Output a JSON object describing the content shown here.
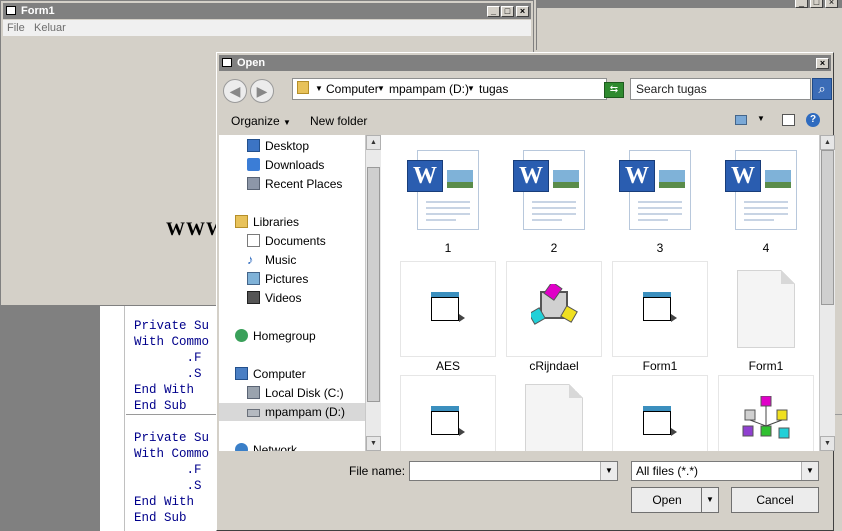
{
  "background_form": {
    "title": "Form1",
    "menu": [
      "File",
      "Keluar"
    ],
    "body_text": "WWW"
  },
  "code_editor": {
    "lines": [
      "Private Su",
      "With Commo",
      "       .F",
      "       .S",
      "End With",
      "End Sub",
      "Private Su",
      "With Commo",
      "       .F",
      "       .S",
      "End With",
      "End Sub"
    ]
  },
  "dialog": {
    "title": "Open",
    "breadcrumb": [
      "Computer",
      "mpampam (D:)",
      "tugas"
    ],
    "search_placeholder": "Search tugas",
    "toolbar": {
      "organize": "Organize",
      "new_folder": "New folder"
    },
    "nav": [
      {
        "label": "Desktop",
        "icon": "desktop-icon"
      },
      {
        "label": "Downloads",
        "icon": "downloads-icon"
      },
      {
        "label": "Recent Places",
        "icon": "recent-places-icon"
      },
      {
        "label": "Libraries",
        "icon": "libraries-icon"
      },
      {
        "label": "Documents",
        "icon": "documents-icon"
      },
      {
        "label": "Music",
        "icon": "music-icon"
      },
      {
        "label": "Pictures",
        "icon": "pictures-icon"
      },
      {
        "label": "Videos",
        "icon": "videos-icon"
      },
      {
        "label": "Homegroup",
        "icon": "homegroup-icon"
      },
      {
        "label": "Computer",
        "icon": "computer-icon"
      },
      {
        "label": "Local Disk (C:)",
        "icon": "local-disk-icon"
      },
      {
        "label": "mpampam (D:)",
        "icon": "drive-icon",
        "selected": true
      },
      {
        "label": "Network",
        "icon": "network-icon"
      }
    ],
    "files": [
      {
        "name": "1",
        "icon": "word-document-icon"
      },
      {
        "name": "2",
        "icon": "word-document-icon"
      },
      {
        "name": "3",
        "icon": "word-document-icon"
      },
      {
        "name": "4",
        "icon": "word-document-icon"
      },
      {
        "name": "AES",
        "icon": "vb-form-icon"
      },
      {
        "name": "cRijndael",
        "icon": "vb-class-icon"
      },
      {
        "name": "Form1",
        "icon": "vb-form-icon"
      },
      {
        "name": "Form1",
        "icon": "blank-file-icon"
      },
      {
        "name": "",
        "icon": "vb-form-icon"
      },
      {
        "name": "",
        "icon": "blank-file-icon"
      },
      {
        "name": "",
        "icon": "vb-form-icon"
      },
      {
        "name": "",
        "icon": "vb-project-icon"
      }
    ],
    "file_name_label": "File name:",
    "file_name_value": "",
    "file_type": "All files (*.*)",
    "open_button": "Open",
    "cancel_button": "Cancel"
  }
}
